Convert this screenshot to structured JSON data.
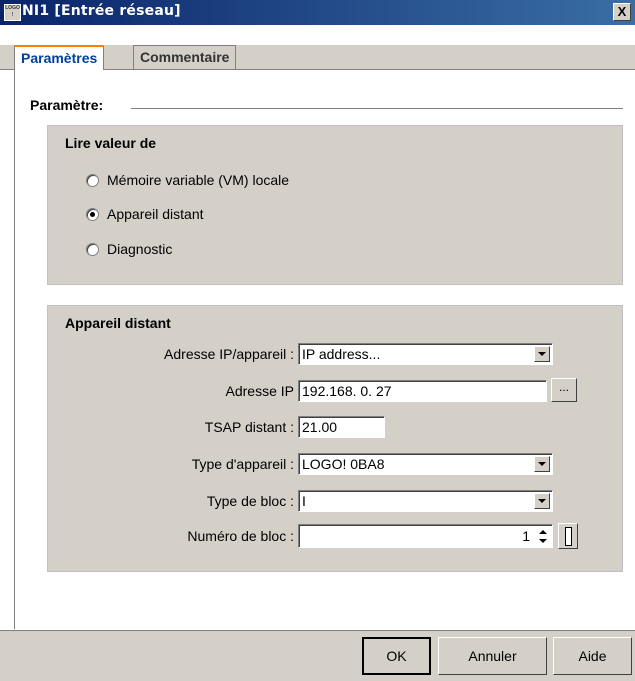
{
  "window": {
    "title": "NI1 [Entrée réseau]",
    "logo_text": [
      "LOGO",
      "!"
    ],
    "close_label": "X"
  },
  "tabs": [
    {
      "label": "Paramètres",
      "active": true
    },
    {
      "label": "Commentaire",
      "active": false
    }
  ],
  "section": {
    "title": "Paramètre:"
  },
  "read_group": {
    "title": "Lire valeur de",
    "options": [
      {
        "label": "Mémoire variable (VM) locale",
        "checked": false
      },
      {
        "label": "Appareil distant",
        "checked": true
      },
      {
        "label": "Diagnostic",
        "checked": false
      }
    ]
  },
  "remote_group": {
    "title": "Appareil distant",
    "ip_device_label": "Adresse IP/appareil :",
    "ip_device_value": "IP address...",
    "ip_label": "Adresse IP",
    "ip_value": "192.168.  0. 27",
    "browse_label": "...",
    "tsap_label": "TSAP distant :",
    "tsap_value": "21.00",
    "device_type_label": "Type d'appareil :",
    "device_type_value": "LOGO! 0BA8",
    "block_type_label": "Type de bloc :",
    "block_type_value": "I",
    "block_number_label": "Numéro de bloc :",
    "block_number_value": "1"
  },
  "buttons": {
    "ok": "OK",
    "cancel": "Annuler",
    "help": "Aide"
  }
}
